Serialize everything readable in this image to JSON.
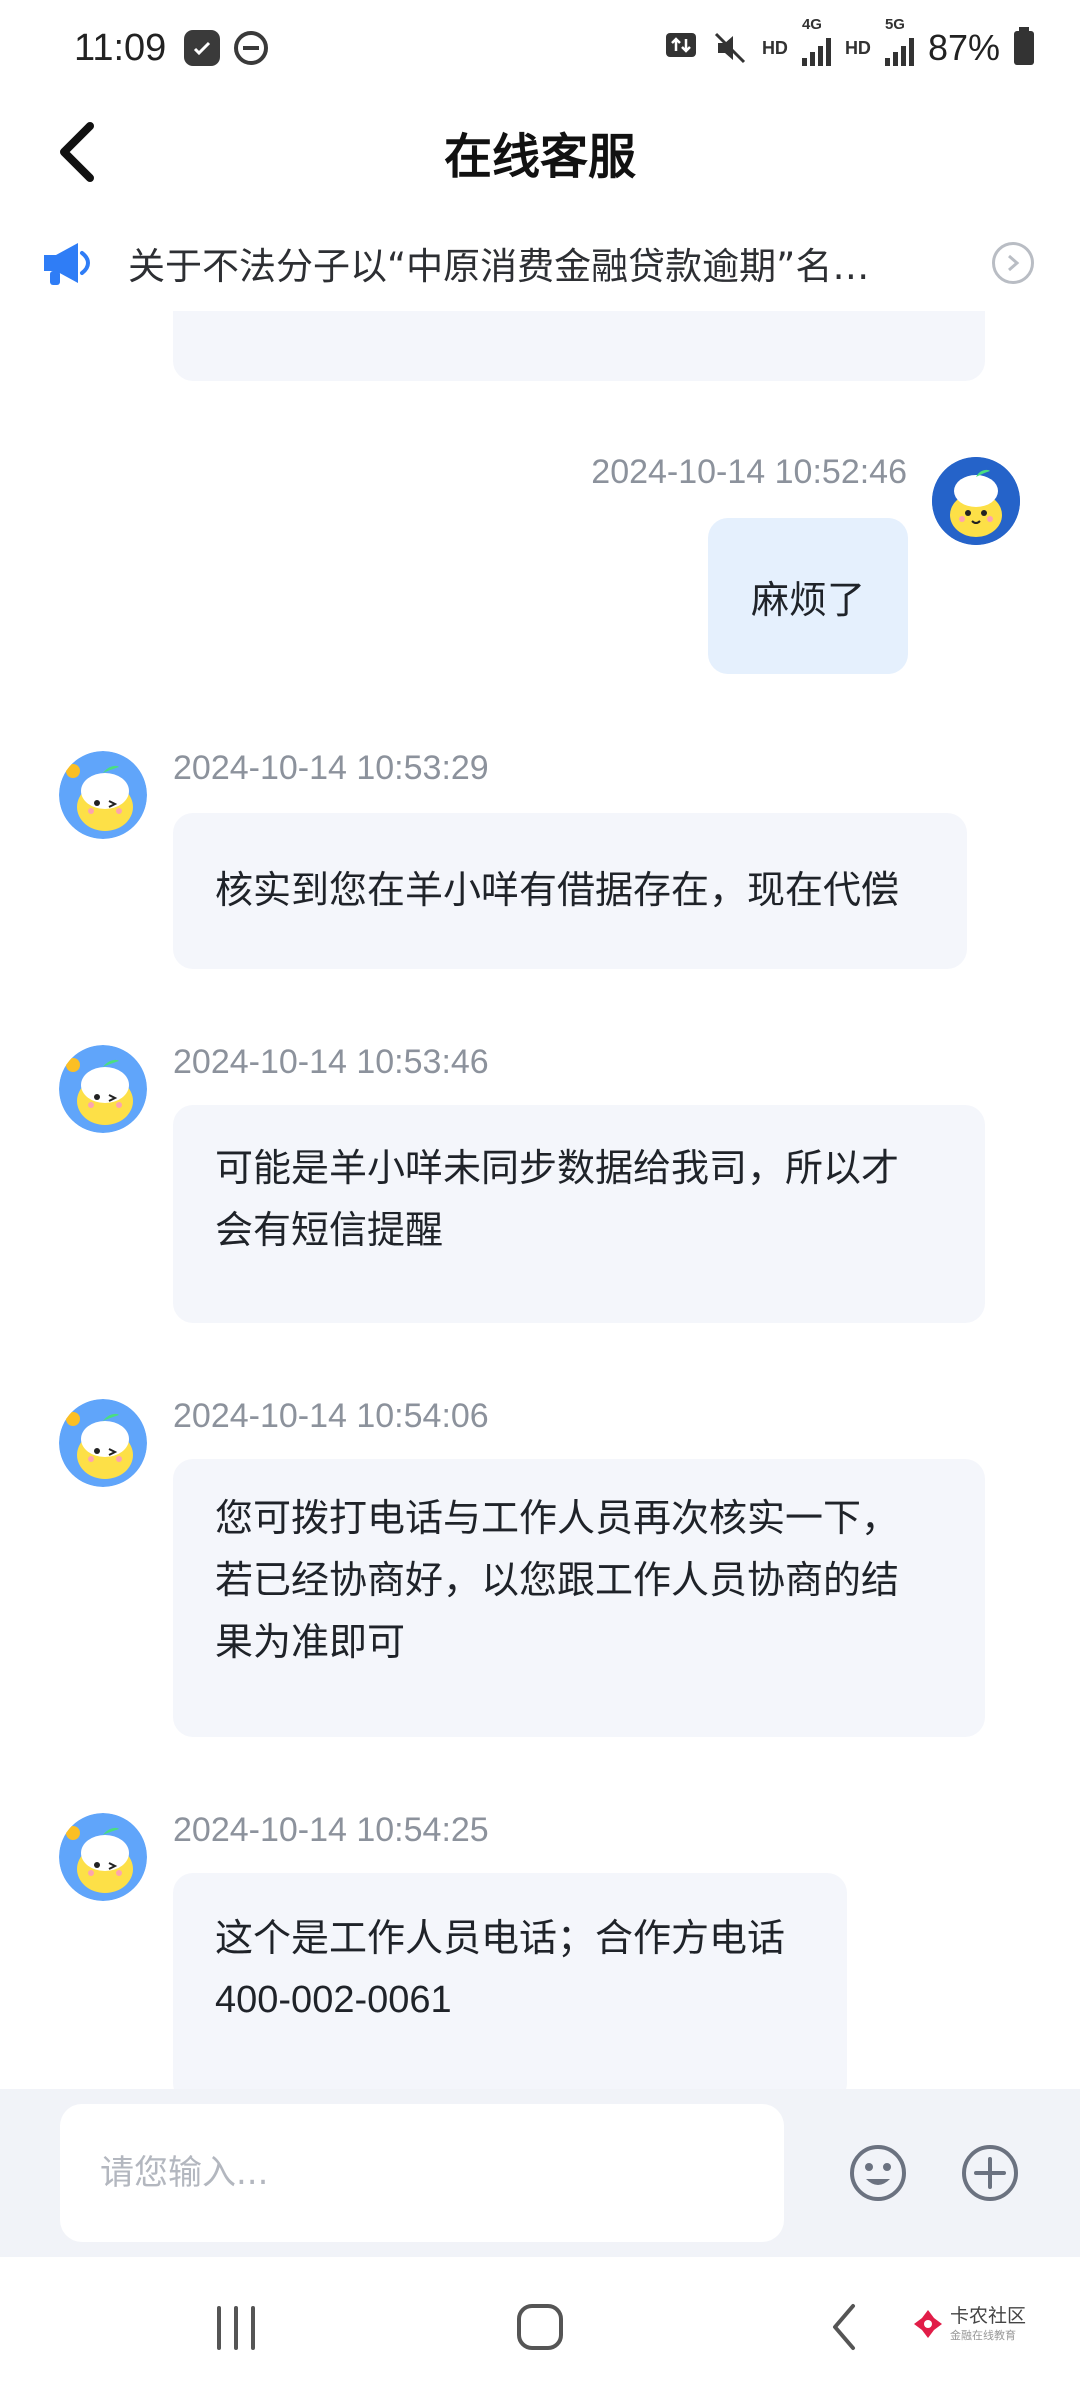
{
  "status_bar": {
    "time": "11:09",
    "network_labels": [
      "HD",
      "4G",
      "HD",
      "5G"
    ],
    "battery": "87%"
  },
  "header": {
    "title": "在线客服"
  },
  "notice": {
    "text": "关于不法分子以“中原消费金融贷款逾期”名…"
  },
  "messages": [
    {
      "side": "right",
      "time": "2024-10-14 10:52:46",
      "text": "麻烦了"
    },
    {
      "side": "left",
      "time": "2024-10-14 10:53:29",
      "lines": [
        "核实到您在羊小咩有借据存在，现在代偿"
      ]
    },
    {
      "side": "left",
      "time": "2024-10-14 10:53:46",
      "lines": [
        "可能是羊小咩未同步数据给我司，所以才",
        "会有短信提醒"
      ]
    },
    {
      "side": "left",
      "time": "2024-10-14 10:54:06",
      "lines": [
        "您可拨打电话与工作人员再次核实一下，",
        "若已经协商好，以您跟工作人员协商的结",
        "果为准即可"
      ]
    },
    {
      "side": "left",
      "time": "2024-10-14 10:54:25",
      "lines": [
        "这个是工作人员电话；合作方电话",
        "400-002-0061"
      ]
    }
  ],
  "input": {
    "placeholder": "请您输入..."
  },
  "watermark": {
    "name": "卡农社区",
    "sub": "金融在线教育"
  },
  "colors": {
    "outgoing_bubble": "#e5f0fd",
    "incoming_bubble": "#f4f6fb",
    "timestamp": "#8c929c",
    "notice_icon": "#2f7df6"
  }
}
